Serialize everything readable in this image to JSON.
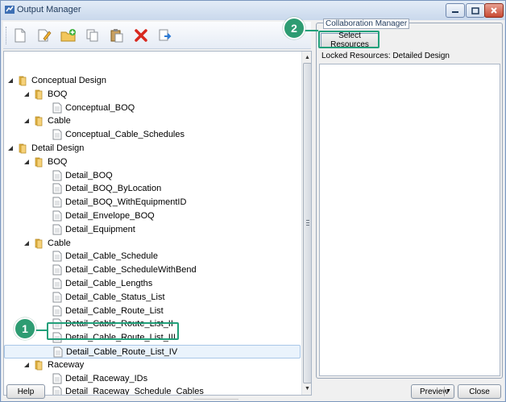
{
  "window": {
    "title": "Output Manager",
    "accent": "#21a07a",
    "badge_color": "#2e9c72"
  },
  "toolbar": {
    "icons": [
      "new-document-icon",
      "edit-icon",
      "add-folder-icon",
      "copy-icon",
      "paste-icon",
      "delete-icon",
      "export-icon"
    ]
  },
  "tree": {
    "rows": [
      {
        "label": "Conceptual Design",
        "level": 0,
        "type": "folder"
      },
      {
        "label": "BOQ",
        "level": 1,
        "type": "folder"
      },
      {
        "label": "Conceptual_BOQ",
        "level": 2,
        "type": "doc"
      },
      {
        "label": "Cable",
        "level": 1,
        "type": "folder"
      },
      {
        "label": "Conceptual_Cable_Schedules",
        "level": 2,
        "type": "doc"
      },
      {
        "label": "Detail Design",
        "level": 0,
        "type": "folder"
      },
      {
        "label": "BOQ",
        "level": 1,
        "type": "folder"
      },
      {
        "label": "Detail_BOQ",
        "level": 2,
        "type": "doc"
      },
      {
        "label": "Detail_BOQ_ByLocation",
        "level": 2,
        "type": "doc"
      },
      {
        "label": "Detail_BOQ_WithEquipmentID",
        "level": 2,
        "type": "doc"
      },
      {
        "label": "Detail_Envelope_BOQ",
        "level": 2,
        "type": "doc"
      },
      {
        "label": "Detail_Equipment",
        "level": 2,
        "type": "doc"
      },
      {
        "label": "Cable",
        "level": 1,
        "type": "folder"
      },
      {
        "label": "Detail_Cable_Schedule",
        "level": 2,
        "type": "doc"
      },
      {
        "label": "Detail_Cable_ScheduleWithBend",
        "level": 2,
        "type": "doc"
      },
      {
        "label": "Detail_Cable_Lengths",
        "level": 2,
        "type": "doc"
      },
      {
        "label": "Detail_Cable_Status_List",
        "level": 2,
        "type": "doc"
      },
      {
        "label": "Detail_Cable_Route_List",
        "level": 2,
        "type": "doc"
      },
      {
        "label": "Detail_Cable_Route_List_II",
        "level": 2,
        "type": "doc"
      },
      {
        "label": "Detail_Cable_Route_List_III",
        "level": 2,
        "type": "doc"
      },
      {
        "label": "Detail_Cable_Route_List_IV",
        "level": 2,
        "type": "doc",
        "selected": true
      },
      {
        "label": "Raceway",
        "level": 1,
        "type": "folder"
      },
      {
        "label": "Detail_Raceway_IDs",
        "level": 2,
        "type": "doc"
      },
      {
        "label": "Detail_Raceway_Schedule_Cables",
        "level": 2,
        "type": "doc"
      }
    ]
  },
  "collab": {
    "title": "Collaboration Manager",
    "select_resources": "Select Resources",
    "locked_resources": "Locked Resources:  Detailed Design"
  },
  "callouts": {
    "one": "1",
    "two": "2"
  },
  "footer": {
    "help": "Help",
    "preview": "Preview",
    "close": "Close"
  }
}
